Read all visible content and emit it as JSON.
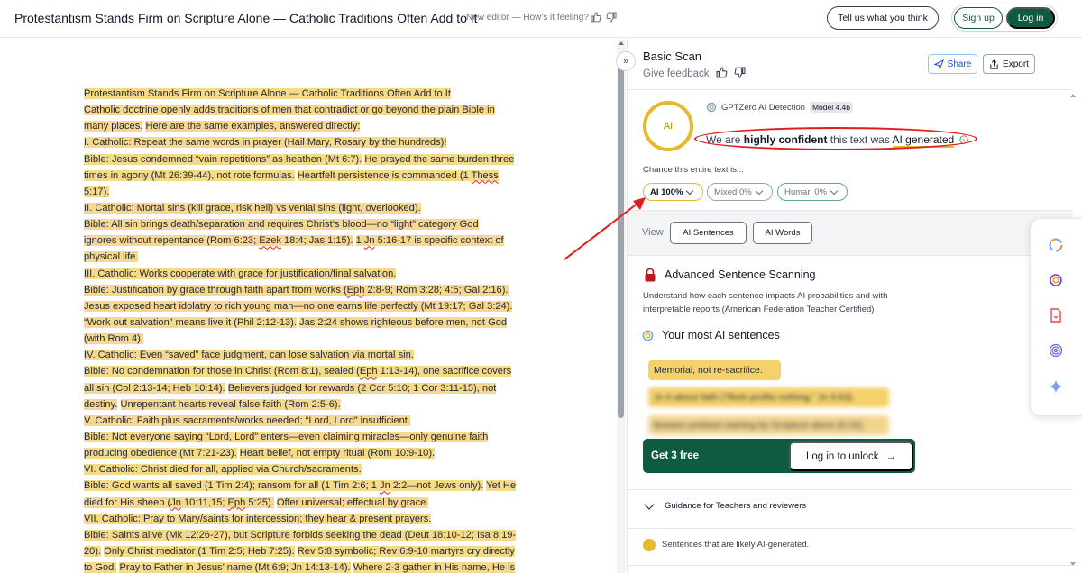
{
  "header": {
    "doc_title": "Protestantism Stands Firm on Scripture Alone — Catholic Traditions Often Add to It",
    "editor_note": "New editor — How's it feeling?",
    "feedback_btn": "Tell us what you think",
    "signup_btn": "Sign up",
    "login_btn": "Log in"
  },
  "document": {
    "lines": [
      [
        {
          "t": "Protestantism Stands Firm on Scripture Alone — Catholic Traditions Often Add to It",
          "h": true
        }
      ],
      [
        {
          "t": "Catholic doctrine openly adds traditions of men that contradict or go beyond the plain Bible in",
          "h": true
        }
      ],
      [
        {
          "t": "many places.",
          "h": true
        },
        {
          "t": " ",
          "h": false
        },
        {
          "t": "Here are the same examples, answered directly:",
          "h": true
        }
      ],
      [
        {
          "t": "I. Catholic: Repeat the same words in prayer (Hail Mary, Rosary by the hundreds)!",
          "h": true
        }
      ],
      [
        {
          "t": "Bible: Jesus condemned “vain repetitions” as heathen (Mt 6:7).",
          "h": true
        },
        {
          "t": " ",
          "h": false
        },
        {
          "t": "He prayed the same burden three",
          "h": true
        }
      ],
      [
        {
          "t": "times in agony (Mt 26:39-44), not rote formulas.",
          "h": true
        },
        {
          "t": " ",
          "h": false
        },
        {
          "t": "Heartfelt persistence is commanded (1 ",
          "h": true
        },
        {
          "t": "Thess",
          "h": true,
          "s": true
        }
      ],
      [
        {
          "t": "5:17).",
          "h": true
        }
      ],
      [
        {
          "t": "II. Catholic: Mortal sins (kill grace, risk hell) vs venial sins (light, overlooked).",
          "h": true
        }
      ],
      [
        {
          "t": "Bible: All sin brings death/separation and requires Christ’s blood—no “light” category God",
          "h": true
        }
      ],
      [
        {
          "t": "ignores without repentance (Rom 6:23; ",
          "h": true
        },
        {
          "t": "Ezek",
          "h": true,
          "s": true
        },
        {
          "t": " 18:4; Jas 1:15).",
          "h": true
        },
        {
          "t": " ",
          "h": false
        },
        {
          "t": "1 ",
          "h": true
        },
        {
          "t": "Jn",
          "h": true,
          "s": true
        },
        {
          "t": " 5:16-17 is specific context of",
          "h": true
        }
      ],
      [
        {
          "t": "physical life.",
          "h": true
        }
      ],
      [
        {
          "t": "III. Catholic: Works cooperate with grace for justification/final salvation.",
          "h": true
        }
      ],
      [
        {
          "t": "Bible: Justification by grace through faith apart from works (",
          "h": true
        },
        {
          "t": "Eph",
          "h": true,
          "s": true
        },
        {
          "t": " 2:8-9; Rom 3:28; 4:5; Gal 2:16).",
          "h": true
        }
      ],
      [
        {
          "t": "Jesus exposed heart idolatry to rich young man—no one earns life perfectly (Mt 19:17; Gal 3:24).",
          "h": true
        }
      ],
      [
        {
          "t": "“Work out salvation” means live it (Phil 2:12-13).",
          "h": true
        },
        {
          "t": " ",
          "h": false
        },
        {
          "t": "Jas 2:24 shows righteous before men, not God",
          "h": true
        }
      ],
      [
        {
          "t": "(with Rom 4).",
          "h": true
        }
      ],
      [
        {
          "t": "IV. Catholic: Even “saved” face judgment, can lose salvation via mortal sin.",
          "h": true
        }
      ],
      [
        {
          "t": "Bible: No condemnation for those in Christ (Rom 8:1), sealed (",
          "h": true
        },
        {
          "t": "Eph",
          "h": true,
          "s": true
        },
        {
          "t": " 1:13-14), one sacrifice covers",
          "h": true
        }
      ],
      [
        {
          "t": "all sin (Col 2:13-14; Heb 10:14).",
          "h": true
        },
        {
          "t": " ",
          "h": false
        },
        {
          "t": "Believers judged for rewards (2 Cor 5:10; 1 Cor 3:11-15), not",
          "h": true
        }
      ],
      [
        {
          "t": "destiny.",
          "h": true
        },
        {
          "t": " ",
          "h": false
        },
        {
          "t": "Unrepentant hearts reveal false faith (Rom 2:5-6).",
          "h": true
        }
      ],
      [
        {
          "t": "V. Catholic: Faith plus sacraments/works needed; “Lord, Lord” insufficient.",
          "h": true
        }
      ],
      [
        {
          "t": "Bible: Not everyone saying “Lord, Lord” enters—even claiming miracles—only genuine faith",
          "h": true
        }
      ],
      [
        {
          "t": "producing obedience (Mt 7:21-23).",
          "h": true
        },
        {
          "t": " ",
          "h": false
        },
        {
          "t": "Heart belief, not empty ritual (Rom 10:9-10).",
          "h": true
        }
      ],
      [
        {
          "t": "VI. Catholic: Christ died for all, applied via Church/sacraments.",
          "h": true
        }
      ],
      [
        {
          "t": "Bible: God wants all saved (1 Tim 2:4); ransom for all (1 Tim 2:6; 1 ",
          "h": true
        },
        {
          "t": "Jn",
          "h": true,
          "s": true
        },
        {
          "t": " 2:2—not Jews only).",
          "h": true
        },
        {
          "t": " ",
          "h": false
        },
        {
          "t": "Yet He",
          "h": true
        }
      ],
      [
        {
          "t": "died for His sheep (",
          "h": true
        },
        {
          "t": "Jn",
          "h": true,
          "s": true
        },
        {
          "t": " 10:11,15; ",
          "h": true
        },
        {
          "t": "Eph",
          "h": true,
          "s": true
        },
        {
          "t": " 5:25).",
          "h": true
        },
        {
          "t": " ",
          "h": false
        },
        {
          "t": "Offer universal; effectual by grace.",
          "h": true
        }
      ],
      [
        {
          "t": "VII. Catholic: Pray to Mary/saints for intercession; they hear & present prayers.",
          "h": true
        }
      ],
      [
        {
          "t": "Bible: Saints alive (Mk 12:26-27), but Scripture forbids seeking the dead (Deut 18:10-12; Isa 8:19-",
          "h": true
        }
      ],
      [
        {
          "t": "20).",
          "h": true
        },
        {
          "t": " ",
          "h": false
        },
        {
          "t": "Only Christ mediator (1 Tim 2:5; Heb 7:25).",
          "h": true
        },
        {
          "t": " ",
          "h": false
        },
        {
          "t": "Rev 5:8 symbolic; Rev 6:9-10 martyrs cry directly",
          "h": true
        }
      ],
      [
        {
          "t": "to God.",
          "h": true
        },
        {
          "t": " ",
          "h": false
        },
        {
          "t": "Pray to Father in Jesus’ name (Mt 6:9; ",
          "h": true
        },
        {
          "t": "Jn",
          "h": true,
          "s": true
        },
        {
          "t": " 14:13-14).",
          "h": true
        },
        {
          "t": " ",
          "h": false
        },
        {
          "t": "Where 2-3 gather in His name, He is",
          "h": true
        }
      ]
    ]
  },
  "panel": {
    "collapse_glyph": "»",
    "title": "Basic Scan",
    "give_feedback": "Give feedback",
    "share_btn": "Share",
    "export_btn": "Export",
    "circle_label": "AI",
    "detection_name": "GPTZero AI Detection",
    "model_badge": "Model 4.4b",
    "confidence_pre": "We are ",
    "confidence_strong": "highly confident",
    "confidence_mid": " this text was ",
    "confidence_result": "AI generated",
    "chance_label": "Chance this entire text is...",
    "pills": {
      "ai": "AI 100%",
      "mixed": "Mixed 0%",
      "human": "Human 0%"
    },
    "view_label": "View",
    "view_sentences": "AI Sentences",
    "view_words": "AI Words",
    "advanced_title": "Advanced Sentence Scanning",
    "advanced_desc": "Understand how each sentence impacts AI probabilities and with interpretable reports (American Federation Teacher Certified)",
    "most_ai_title": "Your most AI sentences",
    "sentences": [
      "Memorial, not re-sacrifice.",
      "Jn 6 about faith (“flesh profits nothing,” Jn 6:63).",
      "Beware prebiset starting by Scripture alone (0:15)."
    ],
    "get_free": "Get 3 free",
    "unlock_btn": "Log in to unlock",
    "unlock_arrow": "→",
    "guidance": "Guidance for Teachers and reviewers",
    "legend": "Sentences that are likely AI-generated."
  },
  "colors": {
    "highlight": "#f7d98b",
    "ai_gold": "#e5b92a",
    "brand_green": "#0f5b3f",
    "annotation_red": "#e11d1d"
  },
  "icons": {
    "header": [
      "thumbs-up-icon",
      "thumbs-down-icon"
    ],
    "panel": [
      "thumbs-up-icon",
      "thumbs-down-icon",
      "share-icon",
      "export-icon",
      "info-icon",
      "lock-icon",
      "gptzero-logo-icon"
    ],
    "float_toolbar": [
      "ring-spinner-icon",
      "target-icon",
      "document-icon",
      "fingerprint-icon",
      "sparkle-icon"
    ]
  }
}
